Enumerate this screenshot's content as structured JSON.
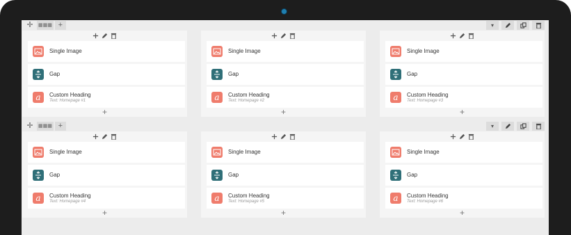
{
  "rows": [
    {
      "toolbar": {
        "move": "✛",
        "layout": "▦▦▦",
        "add": "+",
        "dropdown": "▾"
      },
      "columns": [
        {
          "elements": [
            {
              "title": "Single Image",
              "subtitle": "",
              "icon": "image-icon"
            },
            {
              "title": "Gap",
              "subtitle": "",
              "icon": "gap-icon"
            },
            {
              "title": "Custom Heading",
              "subtitle": "Text: Homepage #1",
              "icon": "heading-icon"
            }
          ],
          "add": "+"
        },
        {
          "elements": [
            {
              "title": "Single Image",
              "subtitle": "",
              "icon": "image-icon"
            },
            {
              "title": "Gap",
              "subtitle": "",
              "icon": "gap-icon"
            },
            {
              "title": "Custom Heading",
              "subtitle": "Text: Homepage #2",
              "icon": "heading-icon"
            }
          ],
          "add": "+"
        },
        {
          "elements": [
            {
              "title": "Single Image",
              "subtitle": "",
              "icon": "image-icon"
            },
            {
              "title": "Gap",
              "subtitle": "",
              "icon": "gap-icon"
            },
            {
              "title": "Custom Heading",
              "subtitle": "Text: Homepage #3",
              "icon": "heading-icon"
            }
          ],
          "add": "+"
        }
      ]
    },
    {
      "toolbar": {
        "move": "✛",
        "layout": "▦▦▦",
        "add": "+",
        "dropdown": "▾"
      },
      "columns": [
        {
          "elements": [
            {
              "title": "Single Image",
              "subtitle": "",
              "icon": "image-icon"
            },
            {
              "title": "Gap",
              "subtitle": "",
              "icon": "gap-icon"
            },
            {
              "title": "Custom Heading",
              "subtitle": "Text: Homepage #4",
              "icon": "heading-icon"
            }
          ],
          "add": "+"
        },
        {
          "elements": [
            {
              "title": "Single Image",
              "subtitle": "",
              "icon": "image-icon"
            },
            {
              "title": "Gap",
              "subtitle": "",
              "icon": "gap-icon"
            },
            {
              "title": "Custom Heading",
              "subtitle": "Text: Homepage #5",
              "icon": "heading-icon"
            }
          ],
          "add": "+"
        },
        {
          "elements": [
            {
              "title": "Single Image",
              "subtitle": "",
              "icon": "image-icon"
            },
            {
              "title": "Gap",
              "subtitle": "",
              "icon": "gap-icon"
            },
            {
              "title": "Custom Heading",
              "subtitle": "Text: Homepage #6",
              "icon": "heading-icon"
            }
          ],
          "add": "+"
        }
      ]
    }
  ],
  "heading_glyph": "a",
  "colors": {
    "accent": "#ef7c6c",
    "gap": "#2f6f78",
    "bezel": "#1d1d1d",
    "canvas": "#ececec"
  }
}
